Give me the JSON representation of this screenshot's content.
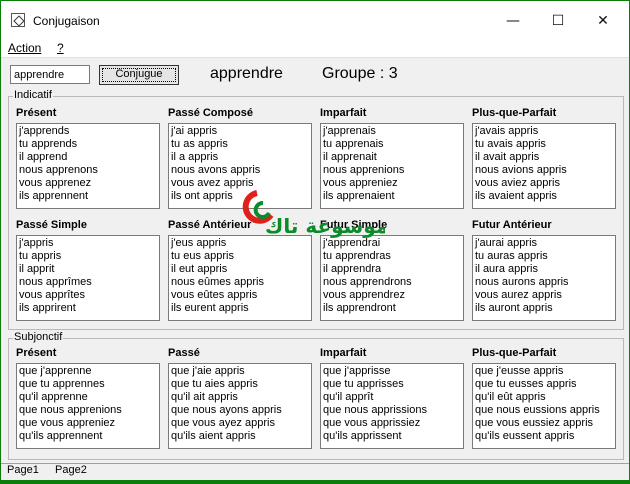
{
  "window": {
    "title": "Conjugaison",
    "minimize": "—",
    "maximize": "☐",
    "close": "✕"
  },
  "menu": {
    "action": "Action",
    "help": "?"
  },
  "toolbar": {
    "input_value": "apprendre",
    "button_label": "Conjugue",
    "verb": "apprendre",
    "groupe": "Groupe : 3"
  },
  "indicatif": {
    "label": "Indicatif",
    "tenses": [
      {
        "name": "Présent",
        "forms": [
          "j'apprends",
          "tu apprends",
          "il apprend",
          "nous apprenons",
          "vous apprenez",
          "ils apprennent"
        ]
      },
      {
        "name": "Passé Composé",
        "forms": [
          "j'ai appris",
          "tu as appris",
          "il a appris",
          "nous avons appris",
          "vous avez appris",
          "ils ont appris"
        ]
      },
      {
        "name": "Imparfait",
        "forms": [
          "j'apprenais",
          "tu apprenais",
          "il apprenait",
          "nous apprenions",
          "vous appreniez",
          "ils apprenaient"
        ]
      },
      {
        "name": "Plus-que-Parfait",
        "forms": [
          "j'avais appris",
          "tu avais appris",
          "il avait appris",
          "nous avions appris",
          "vous aviez appris",
          "ils avaient appris"
        ]
      },
      {
        "name": "Passé Simple",
        "forms": [
          "j'appris",
          "tu appris",
          "il apprit",
          "nous apprîmes",
          "vous apprîtes",
          "ils apprirent"
        ]
      },
      {
        "name": "Passé Antérieur",
        "forms": [
          "j'eus appris",
          "tu eus appris",
          "il eut appris",
          "nous eûmes appris",
          "vous eûtes appris",
          "ils eurent appris"
        ]
      },
      {
        "name": "Futur Simple",
        "forms": [
          "j'apprendrai",
          "tu apprendras",
          "il apprendra",
          "nous apprendrons",
          "vous apprendrez",
          "ils apprendront"
        ]
      },
      {
        "name": "Futur Antérieur",
        "forms": [
          "j'aurai appris",
          "tu auras appris",
          "il aura appris",
          "nous aurons appris",
          "vous aurez appris",
          "ils auront appris"
        ]
      }
    ]
  },
  "subjonctif": {
    "label": "Subjonctif",
    "tenses": [
      {
        "name": "Présent",
        "forms": [
          "que j'apprenne",
          "que tu apprennes",
          "qu'il apprenne",
          "que nous apprenions",
          "que vous appreniez",
          "qu'ils apprennent"
        ]
      },
      {
        "name": "Passé",
        "forms": [
          "que j'aie appris",
          "que tu aies appris",
          "qu'il ait appris",
          "que nous ayons appris",
          "que vous ayez appris",
          "qu'ils aient appris"
        ]
      },
      {
        "name": "Imparfait",
        "forms": [
          "que j'apprisse",
          "que tu apprisses",
          "qu'il apprît",
          "que nous apprissions",
          "que vous apprissiez",
          "qu'ils apprissent"
        ]
      },
      {
        "name": "Plus-que-Parfait",
        "forms": [
          "que j'eusse appris",
          "que tu eusses appris",
          "qu'il eût appris",
          "que nous eussions appris",
          "que vous eussiez appris",
          "qu'ils eussent appris"
        ]
      }
    ]
  },
  "tabs": [
    {
      "label": "Page1"
    },
    {
      "label": "Page2"
    }
  ],
  "watermark": {
    "text": "موسوعة تاك"
  },
  "colors": {
    "frame": "#0b7d0b",
    "watermark_red": "#e0201b",
    "watermark_green": "#0d8a2a"
  }
}
